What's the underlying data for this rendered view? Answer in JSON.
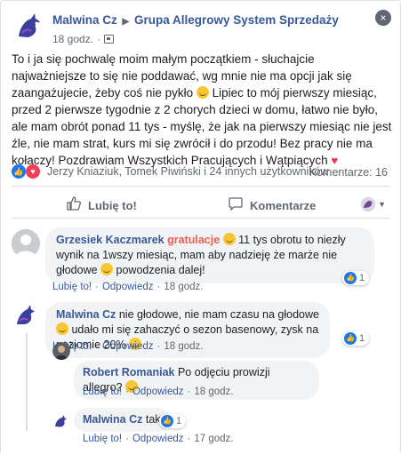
{
  "header": {
    "author": "Malwina Cz",
    "group": "Grupa Allegrowy System Sprzedaży",
    "time": "18 godz.",
    "privacy_icon": "group-icon"
  },
  "post": {
    "p1": "To i ja się pochwalę moim małym początkiem - słuchajcie najważniejsze to się nie poddawać, wg mnie nie ma opcji jak się zaangażujecie, żeby coś nie pykło ",
    "p2": " Lipiec to mój pierwszy miesiąc, przed 2 pierwsze tygodnie z 2 chorych dzieci w domu, łatwo nie było, ale mam obrót ponad 11 tys - myślę, że jak na pierwszy miesiąc nie jest źle, nie mam strat, kurs mi się zwrócił i do przodu! Bez pracy nie ma kołaczy! Pozdrawiam Wszystkich Pracujących i Wątpiących "
  },
  "reactions": {
    "names": "Jerzy Kniaziuk, Tomek Piwiński i 24 innych użytkowników",
    "comments": "Komentarze: 16"
  },
  "actions": {
    "like": "Lubię to!",
    "comment": "Komentarze"
  },
  "comments": [
    {
      "author": "Grzesiek Kaczmarek",
      "tag": "gratulacje",
      "text1": " 11 tys obrotu to niezły wynik na 1wszy miesiąc, mam aby nadzieję że marże nie głodowe ",
      "text2": " powodzenia dalej!",
      "like": "Lubię to!",
      "reply": "Odpowiedz",
      "time": "18 godz.",
      "count": "1"
    },
    {
      "author": "Malwina Cz",
      "text1": " nie głodowe, nie mam czasu na głodowe ",
      "text2": " udało mi się zahaczyć o sezon basenowy, zysk na poziomie 20% ",
      "like": "Lubię to!",
      "reply": "Odpowiedz",
      "time": "18 godz.",
      "count": "1"
    },
    {
      "author": "Robert Romaniak",
      "text1": " Po odjęciu prowizji allegro? ",
      "like": "Lubię to!",
      "reply": "Odpowiedz",
      "time": "18 godz."
    },
    {
      "author": "Malwina Cz",
      "text1": " tak",
      "like": "Lubię to!",
      "reply": "Odpowiedz",
      "time": "17 godz.",
      "count": "1"
    }
  ],
  "sep": "·",
  "colors": {
    "link": "#385898",
    "tag": "#ef5d4e",
    "like": "#1877f2",
    "love": "#f33e58"
  }
}
